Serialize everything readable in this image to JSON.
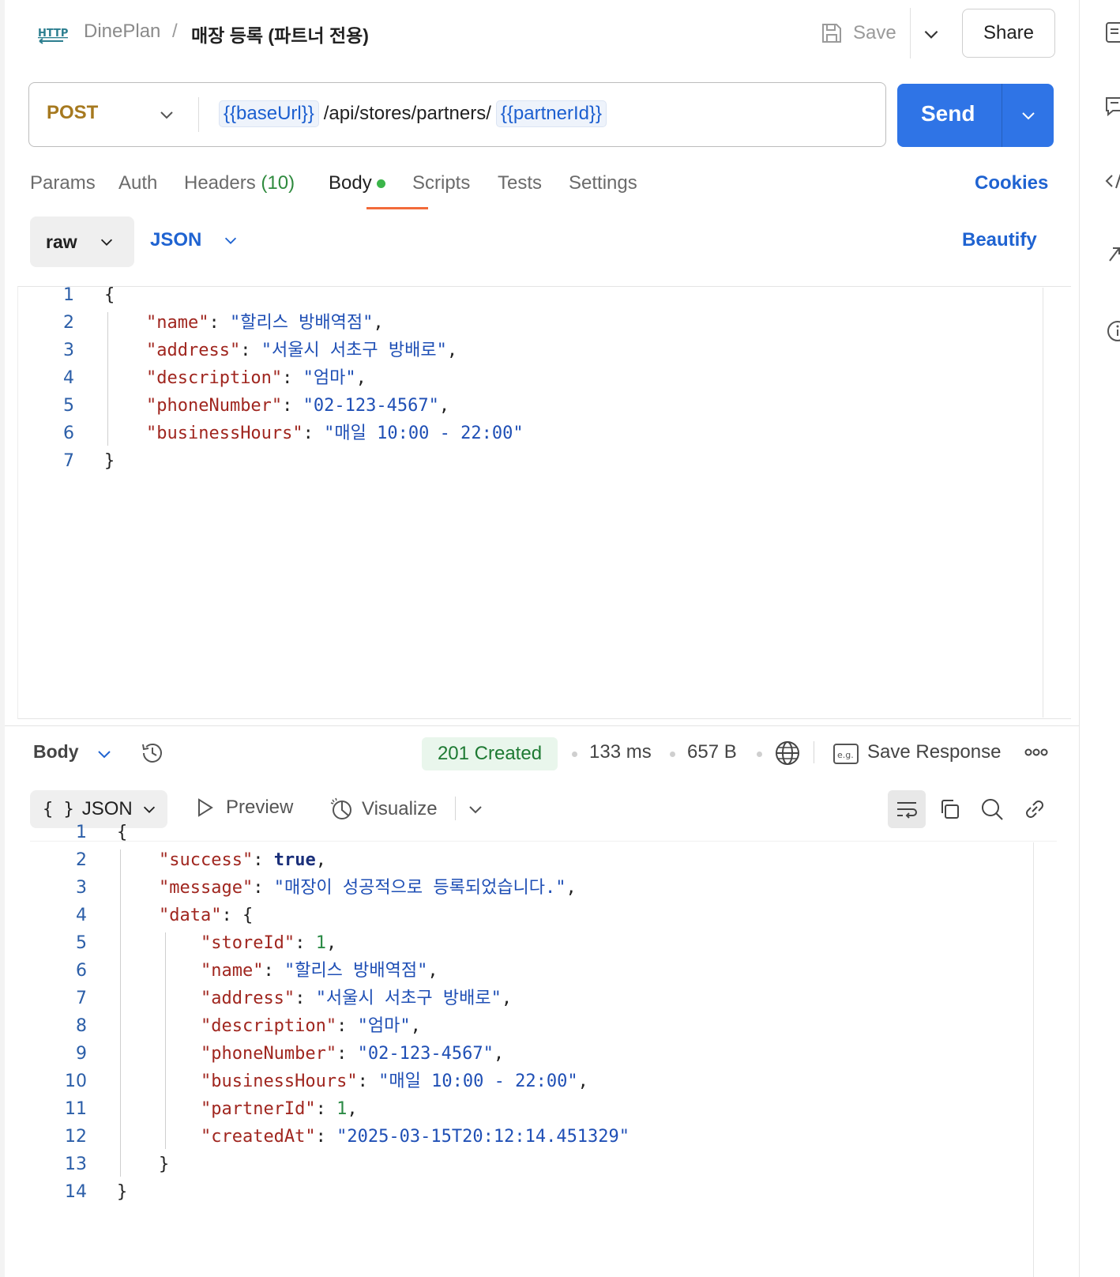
{
  "header": {
    "collection": "DinePlan",
    "separator": "/",
    "request_name": "매장 등록 (파트너 전용)",
    "save_label": "Save",
    "share_label": "Share"
  },
  "request": {
    "method": "POST",
    "url_var_base": "{{baseUrl}}",
    "url_path": "/api/stores/partners/",
    "url_var_partner": "{{partnerId}}",
    "send_label": "Send"
  },
  "tabs": {
    "params": "Params",
    "auth": "Auth",
    "headers": "Headers",
    "headers_count": "(10)",
    "body": "Body",
    "scripts": "Scripts",
    "tests": "Tests",
    "settings": "Settings",
    "cookies": "Cookies",
    "active": "Body"
  },
  "body_options": {
    "mode": "raw",
    "language": "JSON",
    "beautify": "Beautify"
  },
  "request_body": {
    "line_numbers": [
      "1",
      "2",
      "3",
      "4",
      "5",
      "6",
      "7"
    ],
    "lines": [
      "{",
      "    \"name\": \"할리스 방배역점\",",
      "    \"address\": \"서울시 서초구 방배로\",",
      "    \"description\": \"엄마\",",
      "    \"phoneNumber\": \"02-123-4567\",",
      "    \"businessHours\": \"매일 10:00 - 22:00\"",
      "}"
    ]
  },
  "response": {
    "body_tab": "Body",
    "status": "201 Created",
    "time": "133 ms",
    "size": "657 B",
    "save_response": "Save Response",
    "view_mode": "JSON",
    "view_braces": "{ }",
    "preview": "Preview",
    "visualize": "Visualize",
    "line_numbers": [
      "1",
      "2",
      "3",
      "4",
      "5",
      "6",
      "7",
      "8",
      "9",
      "10",
      "11",
      "12",
      "13",
      "14"
    ],
    "lines": [
      "{",
      "    \"success\": true,",
      "    \"message\": \"매장이 성공적으로 등록되었습니다.\",",
      "    \"data\": {",
      "        \"storeId\": 1,",
      "        \"name\": \"할리스 방배역점\",",
      "        \"address\": \"서울시 서초구 방배로\",",
      "        \"description\": \"엄마\",",
      "        \"phoneNumber\": \"02-123-4567\",",
      "        \"businessHours\": \"매일 10:00 - 22:00\",",
      "        \"partnerId\": 1,",
      "        \"createdAt\": \"2025-03-15T20:12:14.451329\"",
      "    }",
      "}"
    ]
  },
  "icons": {
    "http": "http-icon",
    "save": "floppy-disk-icon",
    "history": "history-icon",
    "globe": "globe-icon",
    "example": "eg-icon",
    "more": "more-dots-icon",
    "wrap": "word-wrap-icon",
    "copy": "copy-icon",
    "search": "search-icon",
    "link": "link-icon"
  },
  "colors": {
    "send_button": "#2f74e6",
    "method_post": "#a6791f",
    "active_tab_underline": "#f26b3a",
    "body_dot": "#3bb54a",
    "link_blue": "#1f63d1",
    "status_bg": "#e9f6ec",
    "status_text": "#1e7a33",
    "json_key": "#a0261f",
    "json_string": "#1f4fb5",
    "json_number": "#2a8a44"
  }
}
